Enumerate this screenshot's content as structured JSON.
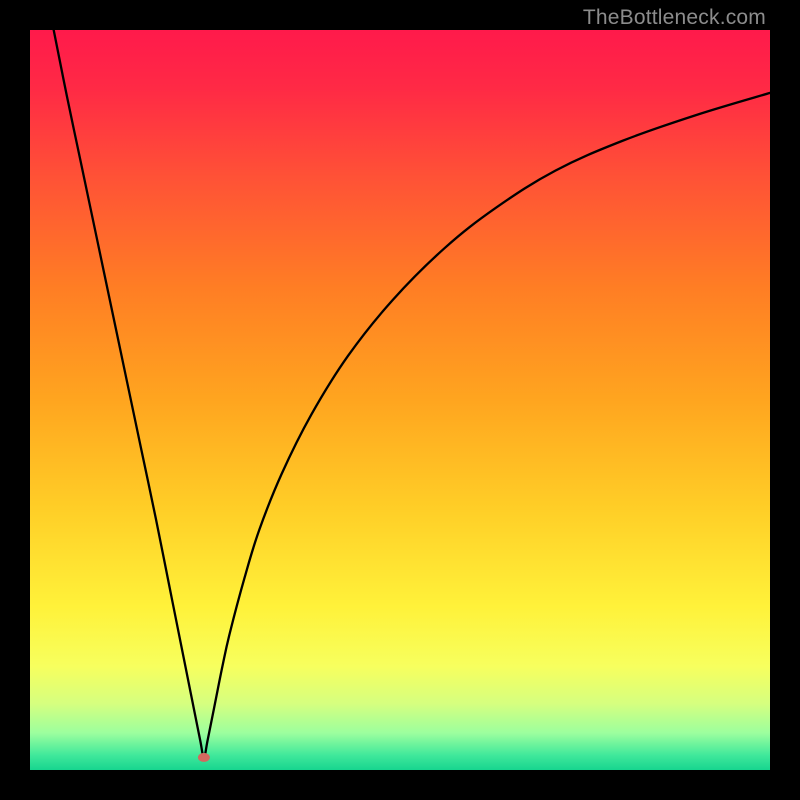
{
  "watermark": "TheBottleneck.com",
  "chart_data": {
    "type": "line",
    "title": "",
    "xlabel": "",
    "ylabel": "",
    "xlim": [
      0,
      100
    ],
    "ylim": [
      0,
      100
    ],
    "grid": false,
    "legend": false,
    "background": {
      "type": "vertical-gradient",
      "stops": [
        {
          "pos": 0.0,
          "color": "#ff1a4b"
        },
        {
          "pos": 0.08,
          "color": "#ff2a45"
        },
        {
          "pos": 0.2,
          "color": "#ff5236"
        },
        {
          "pos": 0.35,
          "color": "#ff7e24"
        },
        {
          "pos": 0.5,
          "color": "#ffa51f"
        },
        {
          "pos": 0.65,
          "color": "#ffcf27"
        },
        {
          "pos": 0.78,
          "color": "#fff23a"
        },
        {
          "pos": 0.86,
          "color": "#f7ff5e"
        },
        {
          "pos": 0.91,
          "color": "#d6ff7f"
        },
        {
          "pos": 0.95,
          "color": "#9cff9e"
        },
        {
          "pos": 0.98,
          "color": "#40e89b"
        },
        {
          "pos": 1.0,
          "color": "#17d58f"
        }
      ]
    },
    "marker": {
      "x": 23.5,
      "y": 1.7,
      "color": "#d3695f",
      "rx": 6,
      "ry": 4.5
    },
    "series": [
      {
        "name": "curve",
        "color": "#000000",
        "stroke_width": 2.3,
        "x": [
          3.2,
          5,
          7,
          9,
          11,
          13,
          15,
          17,
          19,
          21,
          22,
          23,
          23.5,
          24,
          25,
          26,
          27,
          29,
          31,
          34,
          38,
          43,
          49,
          56,
          63,
          71,
          80,
          90,
          100
        ],
        "values": [
          100,
          91,
          81.5,
          72,
          62.5,
          53,
          43.5,
          34,
          24,
          14,
          9,
          4,
          1.7,
          4,
          9,
          14,
          18.5,
          26,
          32.5,
          40,
          48,
          56,
          63.5,
          70.5,
          76,
          81,
          85,
          88.5,
          91.5
        ]
      }
    ]
  }
}
